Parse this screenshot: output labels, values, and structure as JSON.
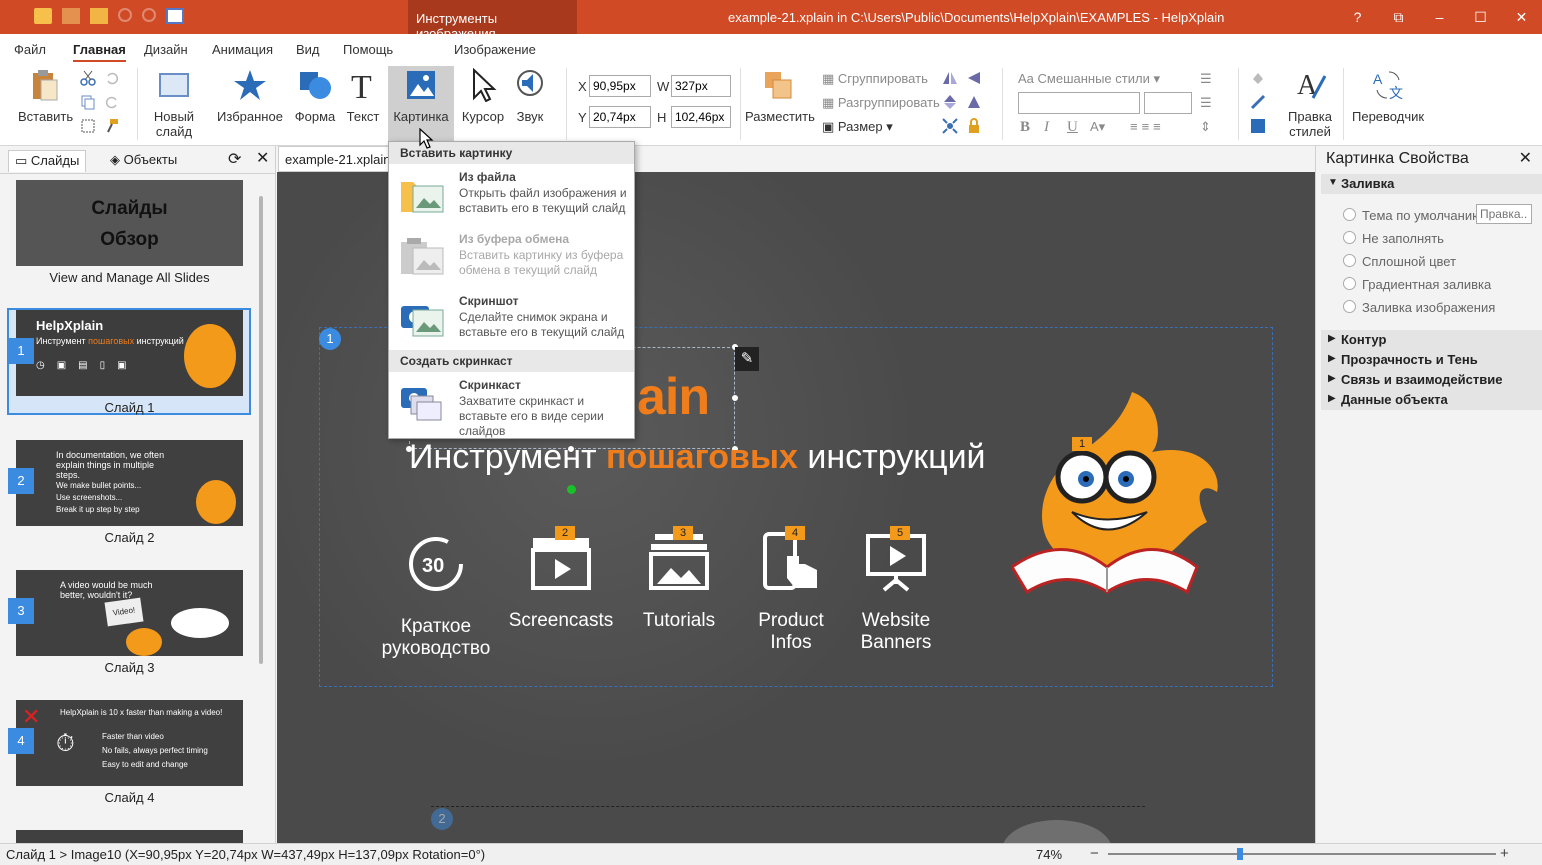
{
  "titlebar": {
    "tools_tab": "Инструменты изображения",
    "title": "example-21.xplain in C:\\Users\\Public\\Documents\\HelpXplain\\EXAMPLES - HelpXplain",
    "help": "?",
    "restore_icon": "⧉",
    "minimize": "–",
    "maximize": "☐",
    "close": "✕"
  },
  "menu": {
    "file": "Файл",
    "home": "Главная",
    "design": "Дизайн",
    "animation": "Анимация",
    "view": "Вид",
    "help": "Помощь",
    "image": "Изображение"
  },
  "ribbon": {
    "paste": "Вставить",
    "new_slide_1": "Новый",
    "new_slide_2": "слайд",
    "favorites": "Избранное",
    "shape": "Форма",
    "text": "Текст",
    "picture": "Картинка",
    "cursor": "Курсор",
    "sound": "Звук",
    "x_label": "X",
    "x_value": "90,95px",
    "w_label": "W",
    "w_value": "327px",
    "y_label": "Y",
    "y_value": "20,74px",
    "h_label": "H",
    "h_value": "102,46px",
    "arrange": "Разместить",
    "group": "Сгруппировать",
    "ungroup": "Разгруппировать",
    "size": "Размер",
    "mixed_styles": "Смешанные стили",
    "edit_styles_1": "Правка",
    "edit_styles_2": "стилей",
    "translator": "Переводчик",
    "bold": "B",
    "italic": "I",
    "underline": "U"
  },
  "leftpanel": {
    "tab_slides": "Слайды",
    "tab_objects": "Объекты",
    "overview_title_1": "Слайды",
    "overview_title_2": "Обзор",
    "overview_label": "View and Manage All Slides",
    "slides": [
      {
        "num": "1",
        "label": "Слайд 1"
      },
      {
        "num": "2",
        "label": "Слайд 2"
      },
      {
        "num": "3",
        "label": "Слайд 3"
      },
      {
        "num": "4",
        "label": "Слайд 4"
      }
    ]
  },
  "document": {
    "tab": "example-21.xplain"
  },
  "canvas": {
    "badge_1": "1",
    "logo_fragment": "ain",
    "headline_a": "Инструмент ",
    "headline_b": "пошаговых",
    "headline_c": " инструкций",
    "features": [
      {
        "num": "",
        "line1": "Краткое",
        "line2": "руководство",
        "icon": "timer-30-icon"
      },
      {
        "num": "2",
        "line1": "Screencasts",
        "line2": "",
        "icon": "clapperboard-icon"
      },
      {
        "num": "3",
        "line1": "Tutorials",
        "line2": "",
        "icon": "picture-stack-icon"
      },
      {
        "num": "4",
        "line1": "Product",
        "line2": "Infos",
        "icon": "phone-touch-icon"
      },
      {
        "num": "5",
        "line1": "Website",
        "line2": "Banners",
        "icon": "presentation-board-icon"
      }
    ],
    "fish_badge": "1",
    "bottom_badge": "2"
  },
  "dropdown": {
    "section1": "Вставить картинку",
    "from_file_title": "Из файла",
    "from_file_desc": "Открыть файл изображения и вставить его в текущий слайд",
    "from_clipboard_title": "Из буфера обмена",
    "from_clipboard_desc": "Вставить картинку из буфера обмена в текущий слайд",
    "screenshot_title": "Скриншот",
    "screenshot_desc": "Сделайте снимок экрана и вставьте его в текущий слайд",
    "section2": "Создать скринкаст",
    "screencast_title": "Скринкаст",
    "screencast_desc": "Захватите скринкаст и вставьте его в виде серии слайдов"
  },
  "rightpanel": {
    "title": "Картинка Свойства",
    "fill_section": "Заливка",
    "fill_options": [
      "Тема по умолчанию",
      "Не заполнять",
      "Сплошной цвет",
      "Градиентная заливка",
      "Заливка изображения"
    ],
    "edit_placeholder": "Правка...",
    "sections": [
      "Контур",
      "Прозрачность и Тень",
      "Связь и взаимодействие",
      "Данные объекта"
    ]
  },
  "statusbar": {
    "text": "Слайд 1 > Image10 (X=90,95px  Y=20,74px  W=437,49px  H=137,09px  Rotation=0°)",
    "zoom": "74%",
    "zoom_level": 0.34,
    "zoom_minus": "−",
    "zoom_plus": "+"
  },
  "colors": {
    "accent": "#d04a26",
    "orange": "#f07d1b",
    "selection": "#3b8be0"
  }
}
